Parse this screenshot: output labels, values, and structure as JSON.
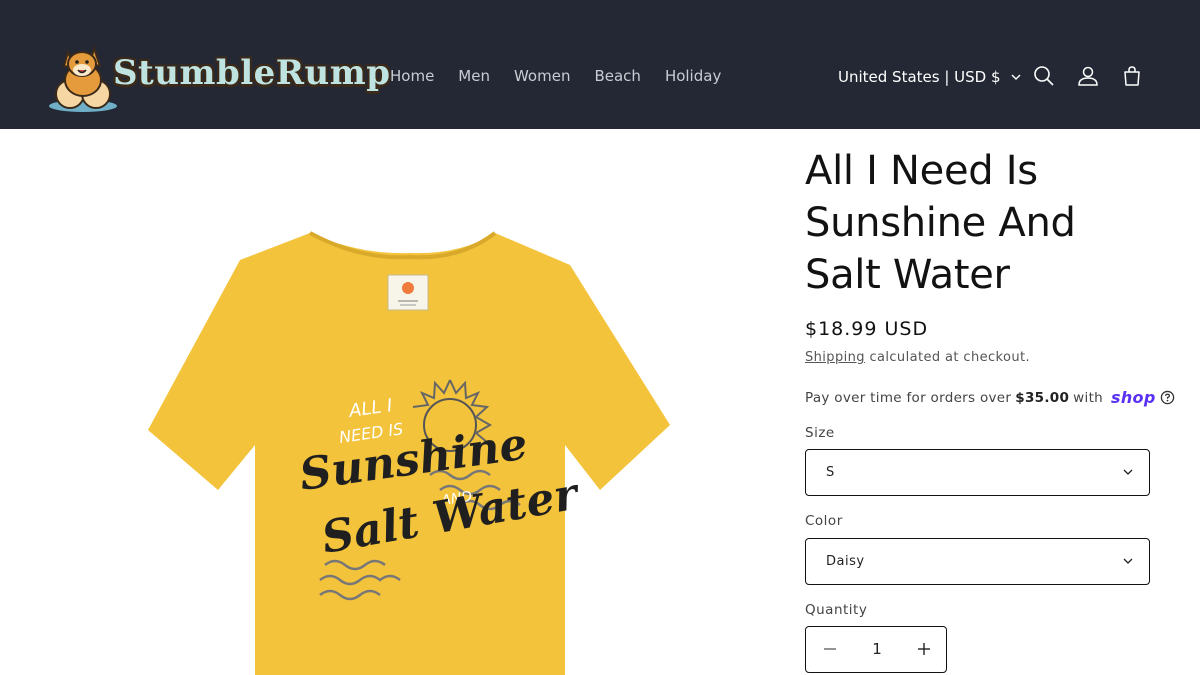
{
  "header": {
    "brand": "StumbleRump",
    "nav": [
      "Home",
      "Men",
      "Women",
      "Beach",
      "Holiday"
    ],
    "locale": "United States | USD $",
    "icons": [
      "search-icon",
      "account-icon",
      "cart-icon"
    ]
  },
  "product": {
    "title": "All I Need Is Sunshine And Salt Water",
    "price": "$18.99 USD",
    "shipping_link": "Shipping",
    "shipping_text": " calculated at checkout.",
    "installments_prefix": "Pay over time for orders over ",
    "installments_amount": "$35.00",
    "installments_suffix": " with",
    "shop_pay": "shop",
    "size_label": "Size",
    "size_value": "S",
    "color_label": "Color",
    "color_value": "Daisy",
    "quantity_label": "Quantity",
    "quantity_value": "1",
    "shirt_print": {
      "line1": "ALL I",
      "line2": "NEED IS",
      "line3": "Sunshine",
      "line4": "AND",
      "line5": "Salt Water"
    }
  },
  "colors": {
    "header_bg": "#232834",
    "shirt": "#f3c33c",
    "shop_pay": "#5a31f4"
  }
}
